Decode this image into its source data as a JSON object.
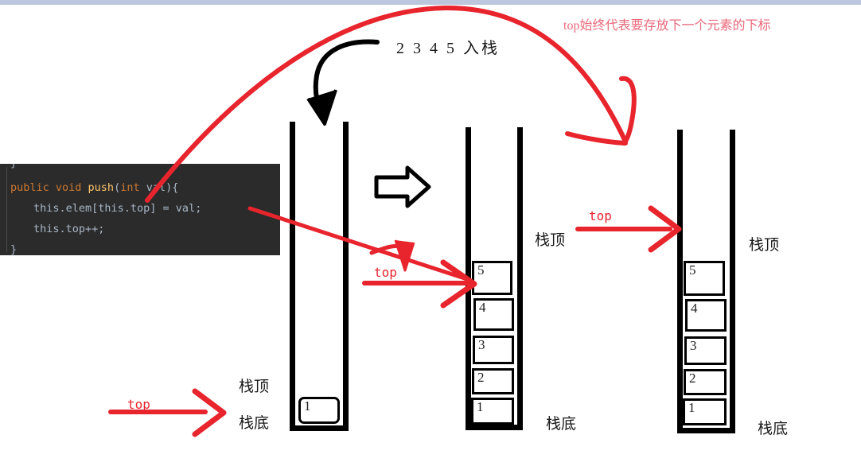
{
  "page": {
    "background": "#ffffff",
    "top_strip_color": "#bcc6dc",
    "annotation_red": "#e8242d",
    "note_red": "#e8697c"
  },
  "code_block": {
    "background": "#2b2b2b",
    "lines": [
      {
        "id": "l0",
        "text": "}"
      },
      {
        "id": "l1_kw",
        "text": "public void "
      },
      {
        "id": "l1_fn",
        "text": "push"
      },
      {
        "id": "l1_p1",
        "text": "("
      },
      {
        "id": "l1_kw2",
        "text": "int"
      },
      {
        "id": "l1_p2",
        "text": " val){"
      },
      {
        "id": "l2",
        "text": "this.elem[this.top] = val;"
      },
      {
        "id": "l3",
        "text": "this.top++;"
      },
      {
        "id": "l4",
        "text": "}"
      }
    ]
  },
  "annotations": {
    "sequence_label": "2 3 4 5 入栈",
    "red_note": "top始终代表要存放下一个元素的下标",
    "top_label_bottom_left": "top",
    "top_label_middle": "top",
    "top_label_right": "top"
  },
  "stacks": [
    {
      "id": "stack1",
      "name": "initial-stack",
      "cells": [
        "1"
      ],
      "label_top": "栈顶",
      "label_bottom": "栈底"
    },
    {
      "id": "stack2",
      "name": "after-push-stack",
      "cells": [
        "5",
        "4",
        "3",
        "2",
        "1"
      ],
      "label_top": "栈顶",
      "label_bottom": "栈底"
    },
    {
      "id": "stack3",
      "name": "final-stack",
      "cells": [
        "5",
        "4",
        "3",
        "2",
        "1"
      ],
      "label_top": "栈顶",
      "label_bottom": "栈底"
    }
  ]
}
